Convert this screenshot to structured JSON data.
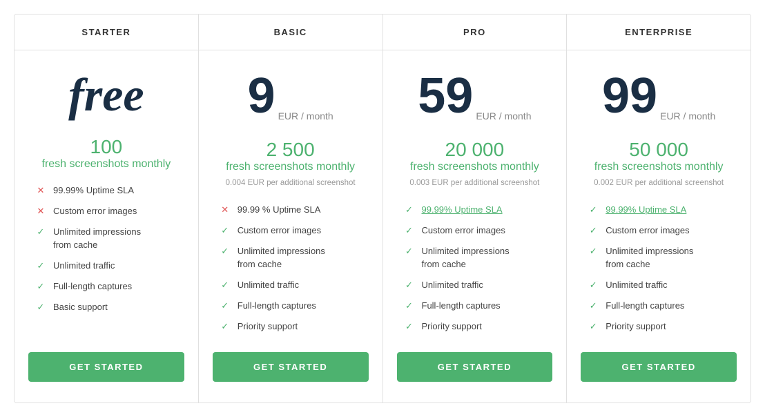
{
  "plans": [
    {
      "id": "starter",
      "name": "STARTER",
      "price_type": "free",
      "price_text": "free",
      "price_number": null,
      "price_unit": null,
      "screenshots_count": "100",
      "screenshots_label": "fresh screenshots monthly",
      "additional_note": null,
      "features": [
        {
          "icon": "cross",
          "text": "99.99% Uptime SLA",
          "link": false
        },
        {
          "icon": "cross",
          "text": "Custom error images",
          "link": false
        },
        {
          "icon": "check",
          "text_lines": [
            "Unlimited impressions",
            "from cache"
          ],
          "link": false
        },
        {
          "icon": "check",
          "text": "Unlimited traffic",
          "link": false
        },
        {
          "icon": "check",
          "text": "Full-length captures",
          "link": false
        },
        {
          "icon": "check",
          "text": "Basic support",
          "link": false
        }
      ],
      "cta": "GET STARTED"
    },
    {
      "id": "basic",
      "name": "BASIC",
      "price_type": "number",
      "price_number": "9",
      "price_unit": "EUR / month",
      "screenshots_count": "2 500",
      "screenshots_label": "fresh screenshots monthly",
      "additional_note": "0.004 EUR per additional screenshot",
      "features": [
        {
          "icon": "cross",
          "text": "99.99 % Uptime SLA",
          "link": false
        },
        {
          "icon": "check",
          "text": "Custom error images",
          "link": false
        },
        {
          "icon": "check",
          "text_lines": [
            "Unlimited impressions",
            "from cache"
          ],
          "link": false
        },
        {
          "icon": "check",
          "text": "Unlimited traffic",
          "link": false
        },
        {
          "icon": "check",
          "text": "Full-length captures",
          "link": false
        },
        {
          "icon": "check",
          "text": "Priority support",
          "link": false
        }
      ],
      "cta": "GET STARTED"
    },
    {
      "id": "pro",
      "name": "PRO",
      "price_type": "number",
      "price_number": "59",
      "price_unit": "EUR / month",
      "screenshots_count": "20 000",
      "screenshots_label": "fresh screenshots monthly",
      "additional_note": "0.003 EUR per additional screenshot",
      "features": [
        {
          "icon": "check",
          "text": "99.99% Uptime SLA",
          "link": true
        },
        {
          "icon": "check",
          "text": "Custom error images",
          "link": false
        },
        {
          "icon": "check",
          "text_lines": [
            "Unlimited impressions",
            "from cache"
          ],
          "link": false
        },
        {
          "icon": "check",
          "text": "Unlimited traffic",
          "link": false
        },
        {
          "icon": "check",
          "text": "Full-length captures",
          "link": false
        },
        {
          "icon": "check",
          "text": "Priority support",
          "link": false
        }
      ],
      "cta": "GET STARTED"
    },
    {
      "id": "enterprise",
      "name": "ENTERPRISE",
      "price_type": "number",
      "price_number": "99",
      "price_unit": "EUR / month",
      "screenshots_count": "50 000",
      "screenshots_label": "fresh screenshots monthly",
      "additional_note": "0.002 EUR per additional screenshot",
      "features": [
        {
          "icon": "check",
          "text": "99.99% Uptime SLA",
          "link": true
        },
        {
          "icon": "check",
          "text": "Custom error images",
          "link": false
        },
        {
          "icon": "check",
          "text_lines": [
            "Unlimited impressions",
            "from cache"
          ],
          "link": false
        },
        {
          "icon": "check",
          "text": "Unlimited traffic",
          "link": false
        },
        {
          "icon": "check",
          "text": "Full-length captures",
          "link": false
        },
        {
          "icon": "check",
          "text": "Priority support",
          "link": false
        }
      ],
      "cta": "GET STARTED"
    }
  ]
}
